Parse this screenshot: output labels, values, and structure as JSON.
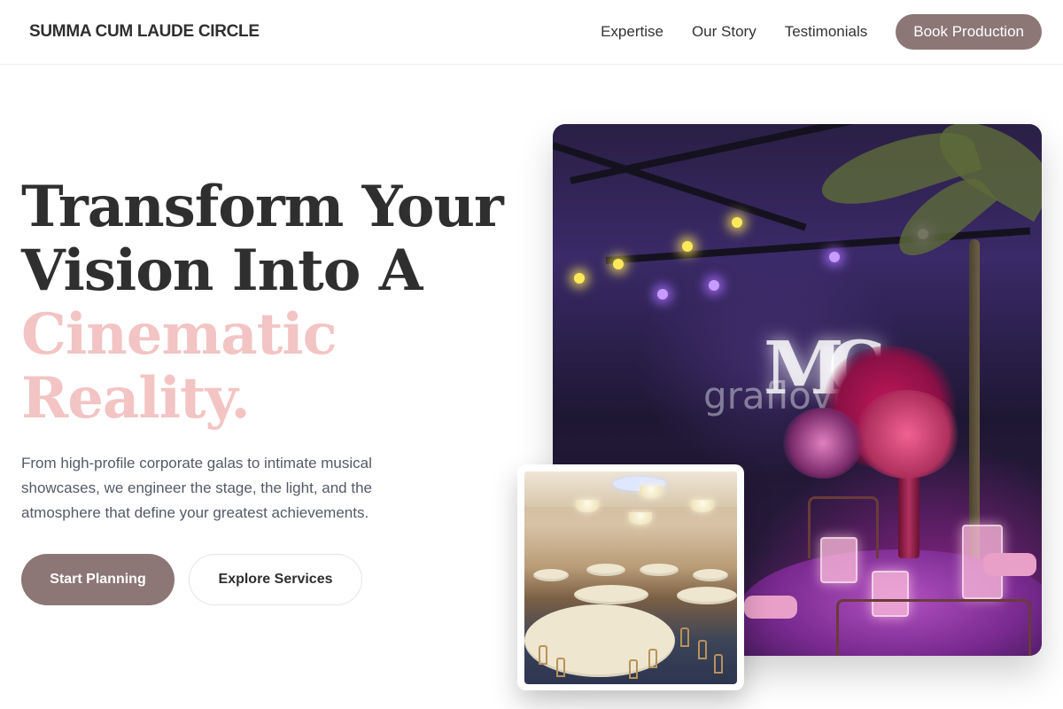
{
  "nav": {
    "brand": "SUMMA CUM LAUDE CIRCLE",
    "links": [
      {
        "label": "Expertise"
      },
      {
        "label": "Our Story"
      },
      {
        "label": "Testimonials"
      }
    ],
    "cta_label": "Book Production"
  },
  "hero": {
    "headline_lines": [
      "Transform Your",
      "Vision Into A"
    ],
    "headline_accent_lines": [
      "Cinematic",
      "Reality."
    ],
    "lead": "From high-profile corporate galas to intimate musical showcases, we engineer the stage, the light, and the atmosphere that define your greatest achievements.",
    "primary_button": "Start Planning",
    "secondary_button": "Explore Services"
  },
  "images": {
    "main_watermark": "graflove",
    "main_monogram": "MC"
  },
  "colors": {
    "accent": "#8c7676",
    "headline_pink": "#f3c4c4",
    "text_dark": "#2f2f2f"
  }
}
